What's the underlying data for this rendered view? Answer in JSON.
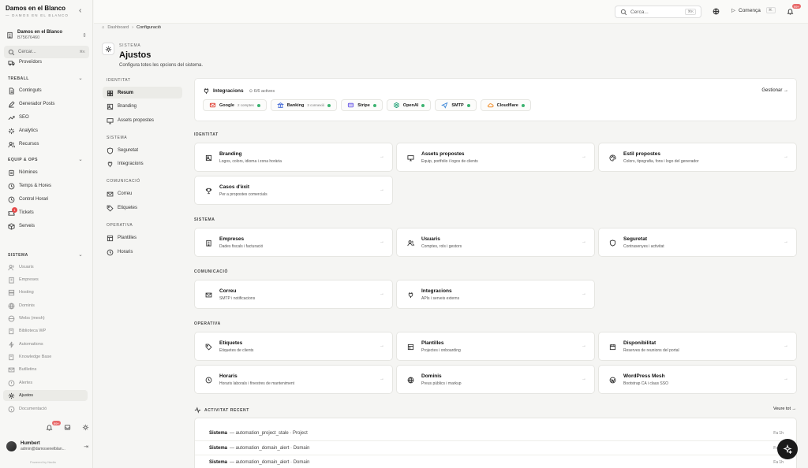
{
  "sidebar": {
    "brand": "Damos en el Blanco",
    "tagline": "— DAMOS EN EL BLANCO",
    "org_name": "Damos en el Blanco",
    "org_id": "B75676460",
    "search_placeholder": "Cercar...",
    "search_shortcut": "⌘K",
    "items_top": [
      {
        "label": "Proveïdors",
        "icon": "truck-icon"
      }
    ],
    "sections": {
      "treball": "TREBALL",
      "equip": "EQUIP & OPS",
      "sistema": "SISTEMA"
    },
    "treball_items": [
      {
        "label": "Continguts",
        "icon": "file-icon"
      },
      {
        "label": "Generador Posts",
        "icon": "edit-icon"
      },
      {
        "label": "SEO",
        "icon": "trending-icon"
      },
      {
        "label": "Analytics",
        "icon": "sparkle-icon"
      },
      {
        "label": "Recursos",
        "icon": "users-icon"
      }
    ],
    "equip_items": [
      {
        "label": "Nòmines",
        "icon": "receipt-icon"
      },
      {
        "label": "Temps & Hores",
        "icon": "clock-icon"
      },
      {
        "label": "Control Horari",
        "icon": "clock-icon"
      },
      {
        "label": "Tickets",
        "icon": "ticket-icon",
        "badge": "1"
      },
      {
        "label": "Serveis",
        "icon": "box-icon"
      }
    ],
    "sistema_items": [
      {
        "label": "Usuaris",
        "icon": "users-icon"
      },
      {
        "label": "Empreses",
        "icon": "building-icon"
      },
      {
        "label": "Hosting",
        "icon": "server-icon"
      },
      {
        "label": "Dominis",
        "icon": "globe-icon"
      },
      {
        "label": "Webs (mesh)",
        "icon": "web-icon"
      },
      {
        "label": "Biblioteca WP",
        "icon": "book-icon"
      },
      {
        "label": "Automations",
        "icon": "bolt-icon"
      },
      {
        "label": "Knowledge Base",
        "icon": "book-icon"
      },
      {
        "label": "Butlletins",
        "icon": "mail-icon"
      },
      {
        "label": "Alertes",
        "icon": "alert-icon"
      },
      {
        "label": "Ajustos",
        "icon": "gear-icon"
      },
      {
        "label": "Documentació",
        "icon": "doc-icon"
      }
    ],
    "notif_count": "99+",
    "user_name": "Humbert",
    "user_email": "admin@damosenelblan...",
    "powered_by": "Powered by Nadia"
  },
  "topbar": {
    "search_placeholder": "Cerca...",
    "search_shortcut": "⌘K",
    "start_label": "Comença",
    "start_shortcut": "⌘.",
    "notif_count": "99+"
  },
  "breadcrumb": {
    "home": "Dashboard",
    "current": "Configuració"
  },
  "header": {
    "kicker": "SISTEMA",
    "title": "Ajustos",
    "subtitle": "Configura totes les opcions del sistema."
  },
  "subnav": {
    "sections": [
      "IDENTITAT",
      "SISTEMA",
      "COMUNICACIÓ",
      "OPERATIVA"
    ],
    "identitat": [
      "Resum",
      "Branding",
      "Assets propostes"
    ],
    "sistema": [
      "Seguretat",
      "Integracions"
    ],
    "comunicacio": [
      "Correu",
      "Etiquetes"
    ],
    "operativa": [
      "Plantilles",
      "Horaris"
    ]
  },
  "integrations": {
    "title": "Integracions",
    "count": "6/6 actives",
    "manage": "Gestionar →",
    "chips": [
      {
        "name": "Google",
        "sub": "2 comptes",
        "color": "#e0463a"
      },
      {
        "name": "Banking",
        "sub": "3 connexió",
        "color": "#4a6fd8"
      },
      {
        "name": "Stripe",
        "sub": "",
        "color": "#6c5ce7"
      },
      {
        "name": "OpenAI",
        "sub": "",
        "color": "#1a9f73"
      },
      {
        "name": "SMTP",
        "sub": "",
        "color": "#3a86d8"
      },
      {
        "name": "Cloudflare",
        "sub": "",
        "color": "#f08a24"
      }
    ]
  },
  "sections": {
    "identitat": "IDENTITAT",
    "sistema": "SISTEMA",
    "comunicacio": "COMUNICACIÓ",
    "operativa": "OPERATIVA"
  },
  "cards": {
    "identitat": [
      {
        "title": "Branding",
        "desc": "Logos, colors, idioma i zona horària",
        "icon": "image-icon"
      },
      {
        "title": "Assets propostes",
        "desc": "Equip, portfolio i logos de clients",
        "icon": "monitor-icon"
      },
      {
        "title": "Estil propostes",
        "desc": "Colors, tipografia, fons i logo del generador",
        "icon": "palette-icon"
      },
      {
        "title": "Casos d'èxit",
        "desc": "Per a propostes comercials",
        "icon": "trophy-icon"
      }
    ],
    "sistema": [
      {
        "title": "Empreses",
        "desc": "Dades fiscals i facturació",
        "icon": "building-icon"
      },
      {
        "title": "Usuaris",
        "desc": "Comptes, rols i gestors",
        "icon": "users-icon"
      },
      {
        "title": "Seguretat",
        "desc": "Contrasenyes i activitat",
        "icon": "shield-icon"
      }
    ],
    "comunicacio": [
      {
        "title": "Correu",
        "desc": "SMTP i notificacions",
        "icon": "mail-icon"
      },
      {
        "title": "Integracions",
        "desc": "APIs i serveis externs",
        "icon": "plug-icon"
      }
    ],
    "operativa": [
      {
        "title": "Etiquetes",
        "desc": "Etiquetes de clients",
        "icon": "tag-icon"
      },
      {
        "title": "Plantilles",
        "desc": "Projectes i onboarding",
        "icon": "template-icon"
      },
      {
        "title": "Disponibilitat",
        "desc": "Reserves de reunions del portal",
        "icon": "calendar-icon"
      },
      {
        "title": "Horaris",
        "desc": "Horaris laborals i finestres de manteniment",
        "icon": "clock-icon"
      },
      {
        "title": "Dominis",
        "desc": "Preus públics i markup",
        "icon": "globe-icon"
      },
      {
        "title": "WordPress Mesh",
        "desc": "Bootstrap CA i claus SSO",
        "icon": "wordpress-icon"
      }
    ]
  },
  "activity": {
    "title": "ACTIVITAT RECENT",
    "see_all": "Veure tot →",
    "rows": [
      {
        "actor": "Sistema",
        "text": "— automation_project_stale · Project",
        "time": "Fa 1h"
      },
      {
        "actor": "Sistema",
        "text": "— automation_domain_alert · Domain",
        "time": "Fa 1h"
      },
      {
        "actor": "Sistema",
        "text": "— automation_domain_alert · Domain",
        "time": "Fa 1h"
      }
    ]
  }
}
